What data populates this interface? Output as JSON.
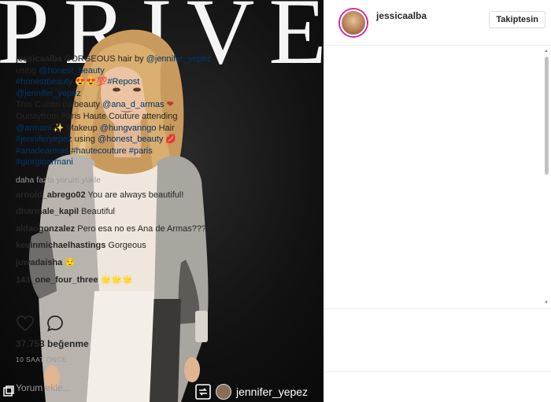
{
  "photo": {
    "backdrop_text": "PRIVE",
    "repost_username": "jennifer_yepez"
  },
  "header": {
    "username": "jessicaalba",
    "follow_button": "Takiptesin"
  },
  "caption": {
    "username": "jessicaalba",
    "t1": " GORGEOUS hair by ",
    "m1": "@jennifer_yepez",
    "t2": " using ",
    "m2": "@honest_beauty",
    "h1": "#honestbeauty",
    "e1": " 😍😍💯",
    "h2": "#Repost",
    "m3": "@jennifer_yepez",
    "t3": "This Cuban cu beauty ",
    "m4": "@ana_d_armas",
    "e2": " ❤",
    "t4": "Outtayfrom Paris Haute Couture attending ",
    "m5": "@armani",
    "t5": " ✨ Makeup ",
    "m6": "@hungvanngo",
    "t6": " Hair ",
    "h3": "#jenniferyepez",
    "t7": " using ",
    "m7": "@honest_beauty",
    "e3": " 💋",
    "h4": "#anadearmas",
    "h5": "#hautecouture",
    "h6": "#paris",
    "h7": "#giorgioarmani"
  },
  "load_more": "daha fazla yorum yükle",
  "comments": [
    {
      "user": "arnold_abrego02",
      "text": "You are always beautiful!"
    },
    {
      "user": "dharmale_kapil",
      "text": "Beautiful"
    },
    {
      "user": "aldaogonzalez",
      "text": "Pero esa no es Ana de Armas????"
    },
    {
      "user": "kevinmichaelhastings",
      "text": "Gorgeous"
    },
    {
      "user": "juwadaisha",
      "text": "😌"
    },
    {
      "user": "143_one_four_three",
      "text": "🌟🌟🌟"
    }
  ],
  "likes": "37.753 beğenme",
  "timestamp": "10 SAAT ÖNCE",
  "comment_placeholder": "Yorum ekle...",
  "icons": {
    "like": "heart-icon",
    "comment": "comment-icon",
    "repost": "repost-icon"
  },
  "colors": {
    "link": "#003569",
    "text": "#262626",
    "muted": "#999999",
    "border": "#efefef"
  }
}
